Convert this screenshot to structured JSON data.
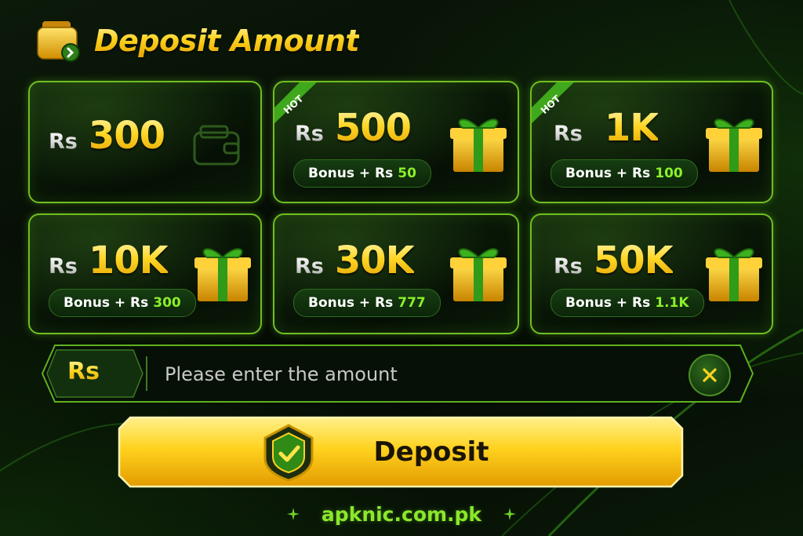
{
  "header": {
    "title": "Deposit Amount",
    "icon": "wallet-icon"
  },
  "currency": "Rs",
  "hot_label": "HOT",
  "bonus_prefix": "Bonus + Rs",
  "options": [
    {
      "amount": "300",
      "hot": false,
      "bonus": null,
      "icon": "wallet-icon"
    },
    {
      "amount": "500",
      "hot": true,
      "bonus": "50",
      "icon": "gift-icon"
    },
    {
      "amount": "1K",
      "hot": true,
      "bonus": "100",
      "icon": "gift-icon"
    },
    {
      "amount": "10K",
      "hot": false,
      "bonus": "300",
      "icon": "gift-icon"
    },
    {
      "amount": "30K",
      "hot": false,
      "bonus": "777",
      "icon": "gift-icon"
    },
    {
      "amount": "50K",
      "hot": false,
      "bonus": "1.1K",
      "icon": "gift-icon"
    }
  ],
  "input": {
    "prefix": "Rs",
    "value": "",
    "placeholder": "Please enter the amount",
    "clear_icon": "close-icon"
  },
  "deposit_button": {
    "label": "Deposit",
    "icon": "shield-check-icon"
  },
  "footer": {
    "text": "apknic.com.pk"
  },
  "colors": {
    "accent_green": "#7cd12a",
    "gold": "#ffd21e",
    "background": "#050b05"
  }
}
